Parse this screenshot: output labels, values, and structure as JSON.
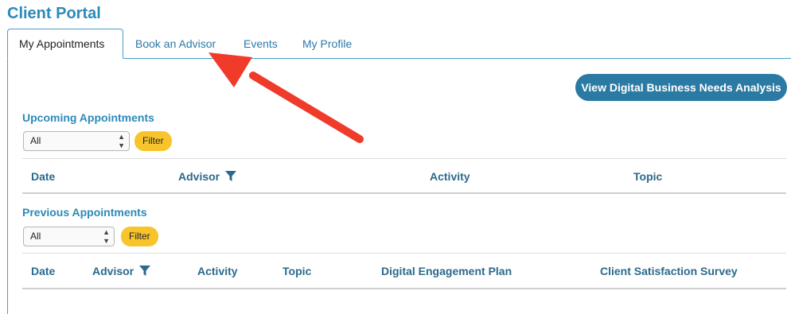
{
  "portal": {
    "title": "Client Portal"
  },
  "tabs": [
    {
      "label": "My Appointments",
      "active": true
    },
    {
      "label": "Book an Advisor",
      "active": false
    },
    {
      "label": "Events",
      "active": false
    },
    {
      "label": "My Profile",
      "active": false
    }
  ],
  "actions": {
    "needs_analysis_label": "View Digital Business Needs Analysis"
  },
  "upcoming": {
    "title": "Upcoming Appointments",
    "filter_select_value": "All",
    "filter_button": "Filter",
    "columns": [
      "Date",
      "Advisor",
      "Activity",
      "Topic"
    ]
  },
  "previous": {
    "title": "Previous Appointments",
    "filter_select_value": "All",
    "filter_button": "Filter",
    "columns": [
      "Date",
      "Advisor",
      "Activity",
      "Topic",
      "Digital Engagement Plan",
      "Client Satisfaction Survey"
    ]
  },
  "icons": {
    "column_filter": "funnel-icon",
    "select_arrows": "updown-arrows-icon"
  },
  "colors": {
    "brand_blue": "#2b8ab8",
    "button_blue": "#2b7aa3",
    "filter_yellow": "#f7c52b",
    "annotation_red": "#f03a2a"
  }
}
